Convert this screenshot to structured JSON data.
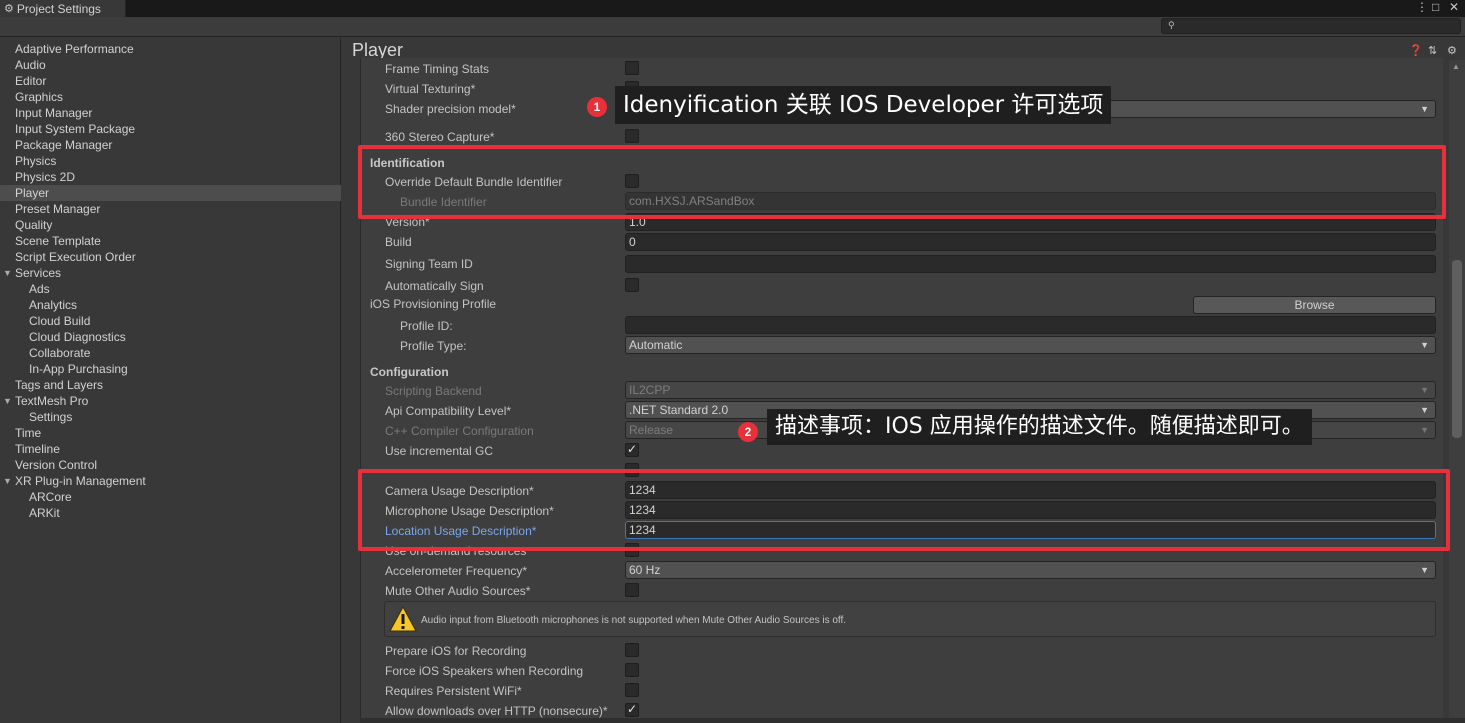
{
  "window": {
    "tab_title": "Project Settings",
    "tab_icon": "gear-icon",
    "menu_icon": "⋮",
    "maximize_icon": "□",
    "close_icon": "✕"
  },
  "search": {
    "placeholder": "",
    "icon": "search-icon"
  },
  "sidebar": {
    "items": [
      {
        "label": "Adaptive Performance",
        "indent": 0
      },
      {
        "label": "Audio",
        "indent": 0
      },
      {
        "label": "Editor",
        "indent": 0
      },
      {
        "label": "Graphics",
        "indent": 0
      },
      {
        "label": "Input Manager",
        "indent": 0
      },
      {
        "label": "Input System Package",
        "indent": 0
      },
      {
        "label": "Package Manager",
        "indent": 0
      },
      {
        "label": "Physics",
        "indent": 0
      },
      {
        "label": "Physics 2D",
        "indent": 0
      },
      {
        "label": "Player",
        "indent": 0,
        "selected": true
      },
      {
        "label": "Preset Manager",
        "indent": 0
      },
      {
        "label": "Quality",
        "indent": 0
      },
      {
        "label": "Scene Template",
        "indent": 0
      },
      {
        "label": "Script Execution Order",
        "indent": 0
      },
      {
        "label": "Services",
        "indent": 0,
        "expanded": true
      },
      {
        "label": "Ads",
        "indent": 1
      },
      {
        "label": "Analytics",
        "indent": 1
      },
      {
        "label": "Cloud Build",
        "indent": 1
      },
      {
        "label": "Cloud Diagnostics",
        "indent": 1
      },
      {
        "label": "Collaborate",
        "indent": 1
      },
      {
        "label": "In-App Purchasing",
        "indent": 1
      },
      {
        "label": "Tags and Layers",
        "indent": 0
      },
      {
        "label": "TextMesh Pro",
        "indent": 0,
        "expanded": true
      },
      {
        "label": "Settings",
        "indent": 1
      },
      {
        "label": "Time",
        "indent": 0
      },
      {
        "label": "Timeline",
        "indent": 0
      },
      {
        "label": "Version Control",
        "indent": 0
      },
      {
        "label": "XR Plug-in Management",
        "indent": 0,
        "expanded": true
      },
      {
        "label": "ARCore",
        "indent": 1
      },
      {
        "label": "ARKit",
        "indent": 1
      }
    ]
  },
  "main": {
    "title": "Player",
    "header_icons": [
      "help-icon",
      "preset-icon",
      "settings-icon"
    ],
    "rows": {
      "frame_timing": "Frame Timing Stats",
      "virtual_texturing": "Virtual Texturing*",
      "shader_precision": "Shader precision model*",
      "shader_precision_value": "",
      "stereo_capture": "360 Stereo Capture*",
      "identification_header": "Identification",
      "override_bundle": "Override Default Bundle Identifier",
      "bundle_identifier": "Bundle Identifier",
      "bundle_identifier_value": "com.HXSJ.ARSandBox",
      "version": "Version*",
      "version_value": "1.0",
      "build": "Build",
      "build_value": "0",
      "signing_team": "Signing Team ID",
      "signing_team_value": "",
      "auto_sign": "Automatically Sign",
      "provisioning_profile": "iOS Provisioning Profile",
      "browse": "Browse",
      "profile_id": "Profile ID:",
      "profile_id_value": "",
      "profile_type": "Profile Type:",
      "profile_type_value": "Automatic",
      "configuration_header": "Configuration",
      "scripting_backend": "Scripting Backend",
      "scripting_backend_value": "IL2CPP",
      "api_compat": "Api Compatibility Level*",
      "api_compat_value": ".NET Standard 2.0",
      "cpp_compiler": "C++ Compiler Configuration",
      "cpp_compiler_value": "Release",
      "incremental_gc": "Use incremental GC",
      "camera_usage": "Camera Usage Description*",
      "camera_usage_value": "1234",
      "microphone_usage": "Microphone Usage Description*",
      "microphone_usage_value": "1234",
      "location_usage": "Location Usage Description*",
      "location_usage_value": "1234",
      "on_demand": "Use on-demand resources",
      "accelerometer": "Accelerometer Frequency*",
      "accelerometer_value": "60 Hz",
      "mute_audio": "Mute Other Audio Sources*",
      "warning_text": "Audio input from Bluetooth microphones is not supported when Mute Other Audio Sources is off.",
      "prepare_recording": "Prepare iOS for Recording",
      "force_speakers": "Force iOS Speakers when Recording",
      "persistent_wifi": "Requires Persistent WiFi*",
      "allow_http": "Allow downloads over HTTP (nonsecure)*"
    },
    "checkboxes": {
      "incremental_gc": true,
      "allow_http": true
    }
  },
  "annotations": {
    "callout1_badge": "1",
    "callout1_text": "Idenyification  关联 IOS Developer 许可选项",
    "callout2_badge": "2",
    "callout2_text": "描述事项：IOS 应用操作的描述文件。随便描述即可。",
    "box_color": "#e8303a"
  },
  "colors": {
    "background": "#383838",
    "panel": "#3e3e3e",
    "selected": "#4d4d4d",
    "link": "#7aa7ea",
    "focus": "#3a79bb"
  }
}
